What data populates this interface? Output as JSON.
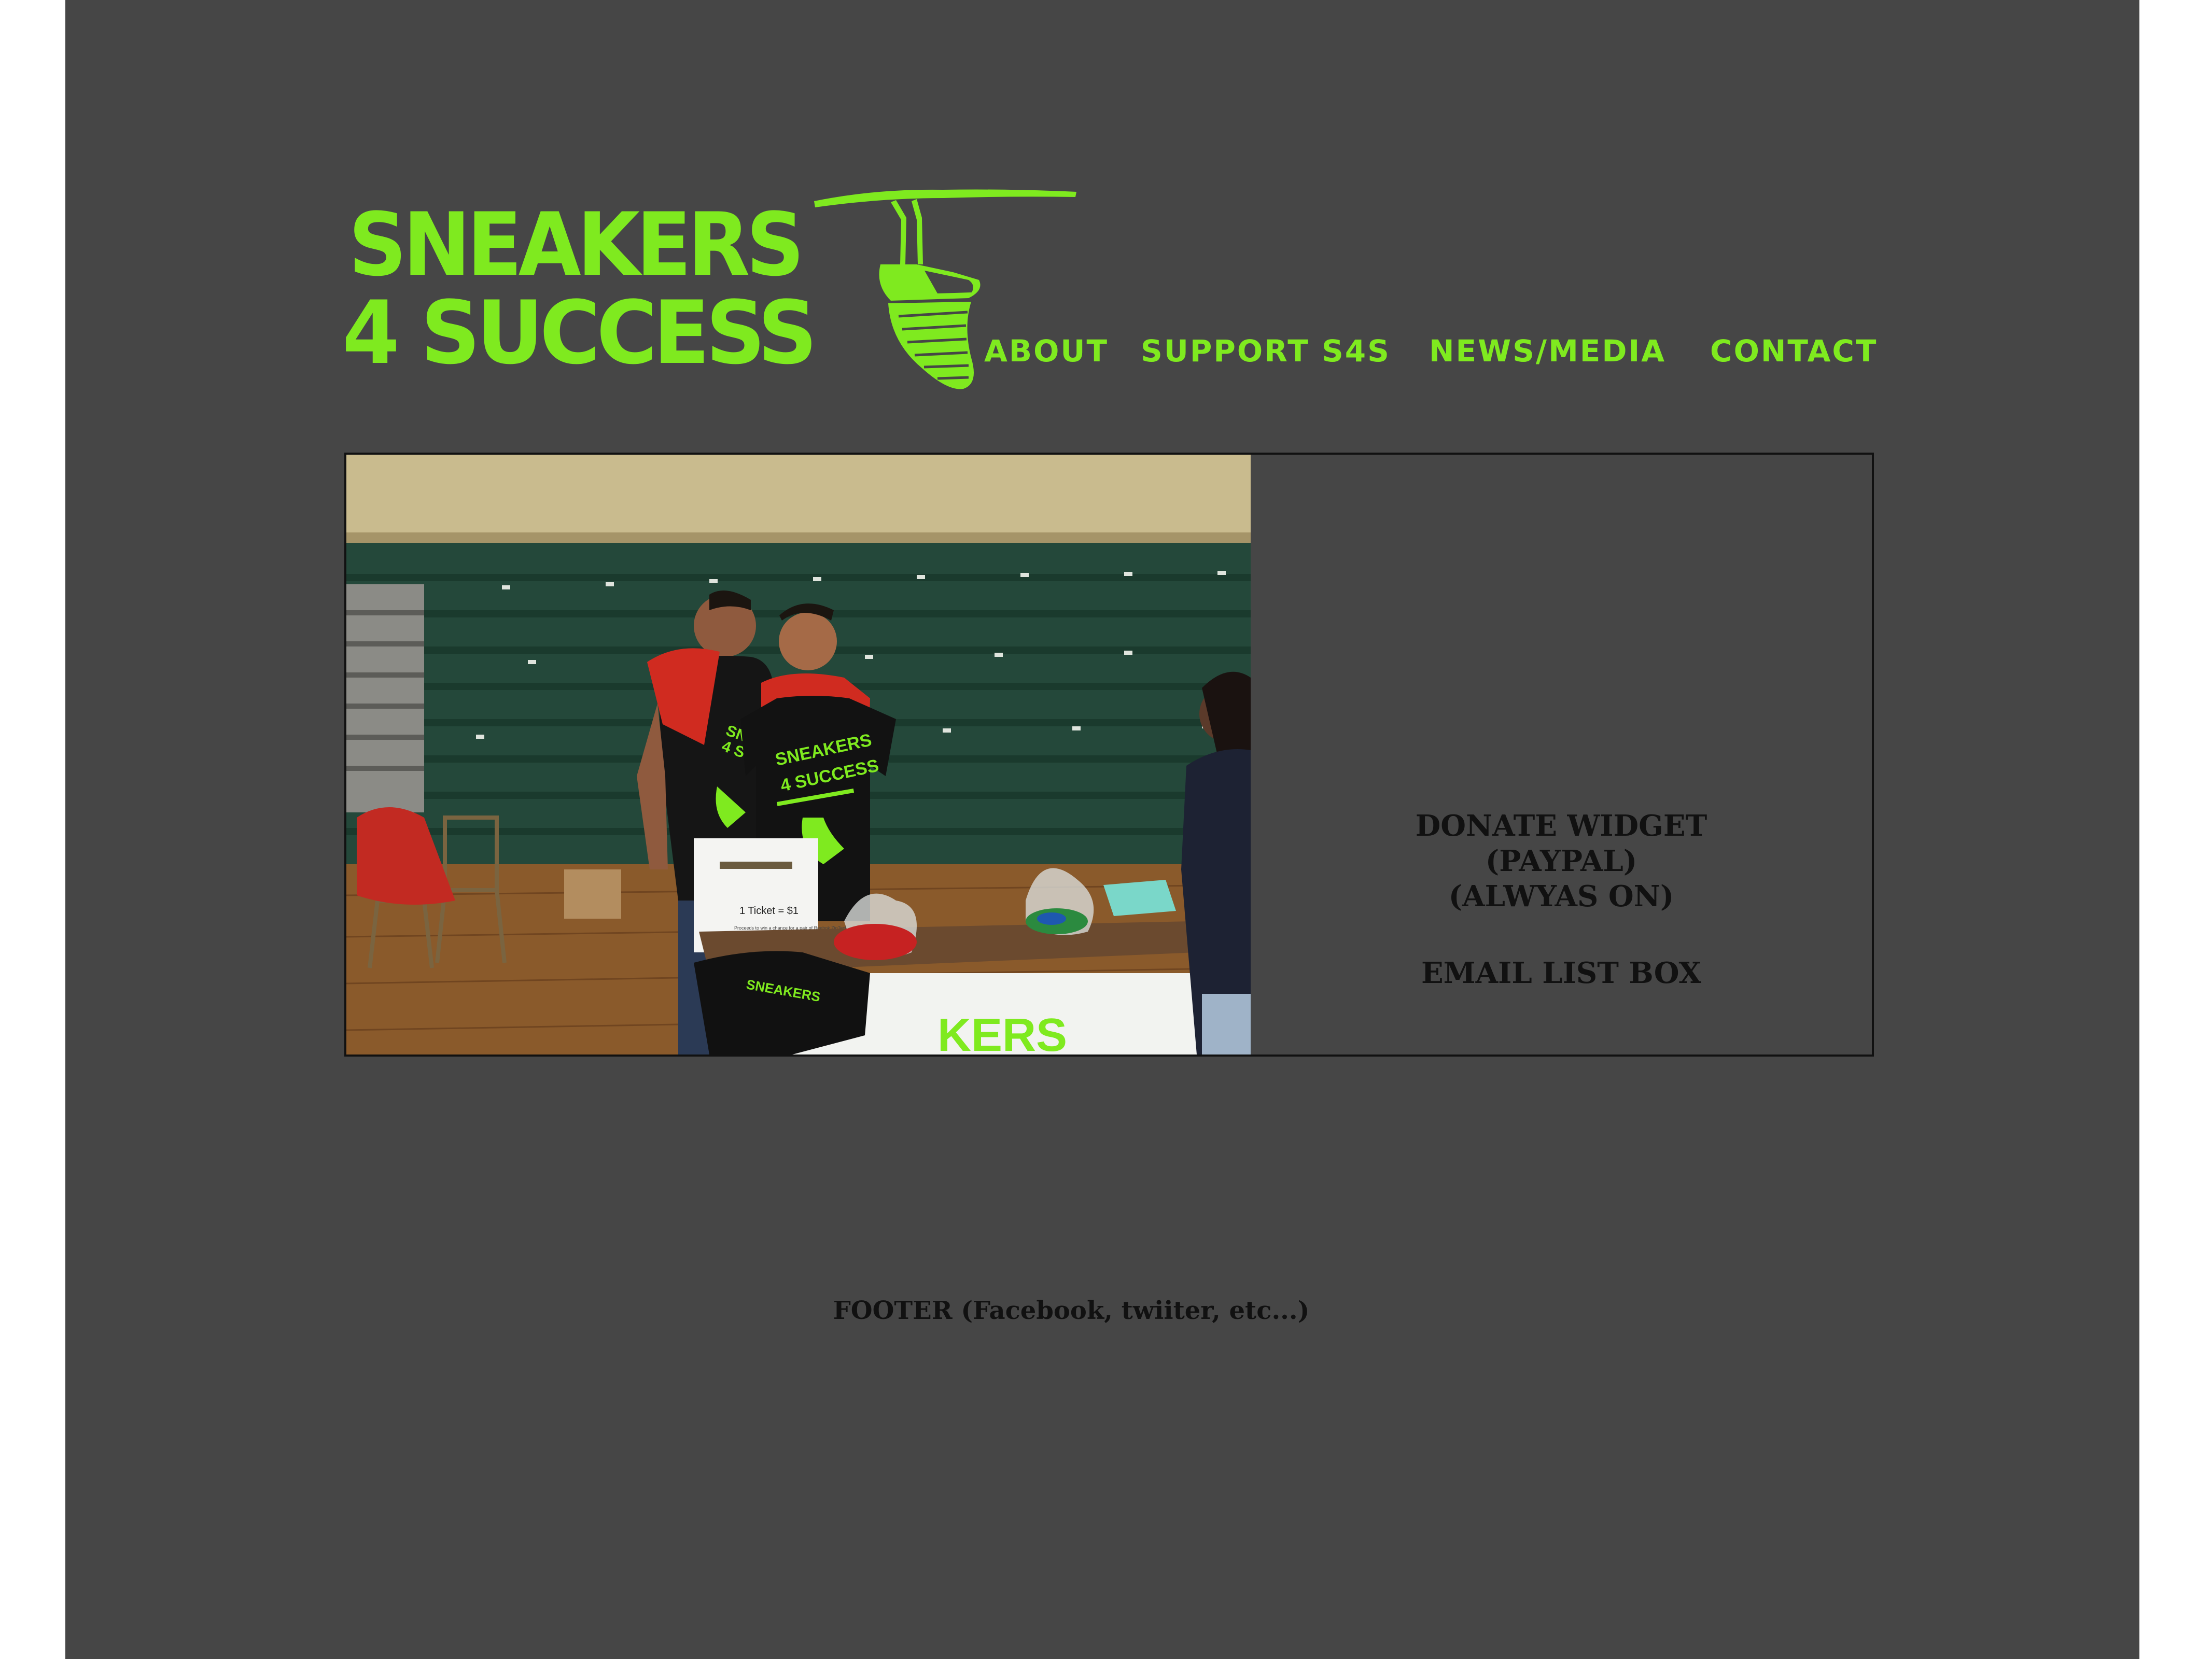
{
  "brand": {
    "line1": "SNEAKERS",
    "line2": "4 SUCCESS",
    "color": "#7fea1f",
    "icon": "hanging-sneaker-icon"
  },
  "nav": {
    "about": "ABOUT",
    "support": "SUPPORT S4S",
    "news": "NEWS/MEDIA",
    "contact": "CONTACT"
  },
  "hero": {
    "photo_text": {
      "shirt_logo_line1": "SNEAKERS",
      "shirt_logo_line2": "4 SUCCESS",
      "ticket_sign": "1 Ticket = $1",
      "ticket_sign_subtext": "Proceeds to win a chance for a pair of Reebok ZigTech",
      "banner_text": "KERS"
    }
  },
  "sidebar": {
    "donate_line1": "DONATE WIDGET",
    "donate_line2": "(PAYPAL)",
    "donate_line3": "(ALWYAS ON)",
    "email_box": "EMAIL LIST BOX"
  },
  "footer": {
    "text": "FOOTER (Facebook, twiiter, etc...)"
  },
  "colors": {
    "page_background": "#464646",
    "outer_background": "#ffffff",
    "accent": "#7fea1f",
    "text_dark": "#111111"
  }
}
